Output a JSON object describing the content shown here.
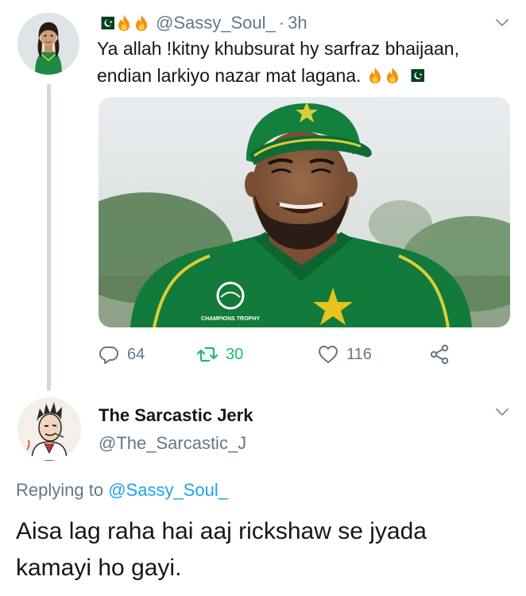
{
  "tweet": {
    "handle": "@Sassy_Soul_",
    "separator": "·",
    "time": "3h",
    "text": "Ya allah !kitny khubsurat hy sarfraz bhaijaan, endian larkiyo nazar mat lagana.",
    "head_emojis": [
      "pakistan-flag",
      "fire",
      "fire"
    ],
    "text_emojis": [
      "fire",
      "fire",
      "pakistan-flag"
    ],
    "image_jersey_text": "CHAMPIONS TROPHY",
    "stats": {
      "replies": "64",
      "retweets": "30",
      "likes": "116"
    }
  },
  "reply": {
    "name": "The Sarcastic Jerk",
    "handle": "@The_Sarcastic_J",
    "replying_prefix": "Replying to",
    "replying_mention": "@Sassy_Soul_",
    "text": "Aisa lag raha hai aaj rickshaw se jyada kamayi ho gayi."
  },
  "colors": {
    "secondary_text": "#657786",
    "mention": "#1da1f2",
    "retweet": "#17bf63",
    "jersey_green": "#127a3a",
    "thread_line": "#cfd9de"
  }
}
